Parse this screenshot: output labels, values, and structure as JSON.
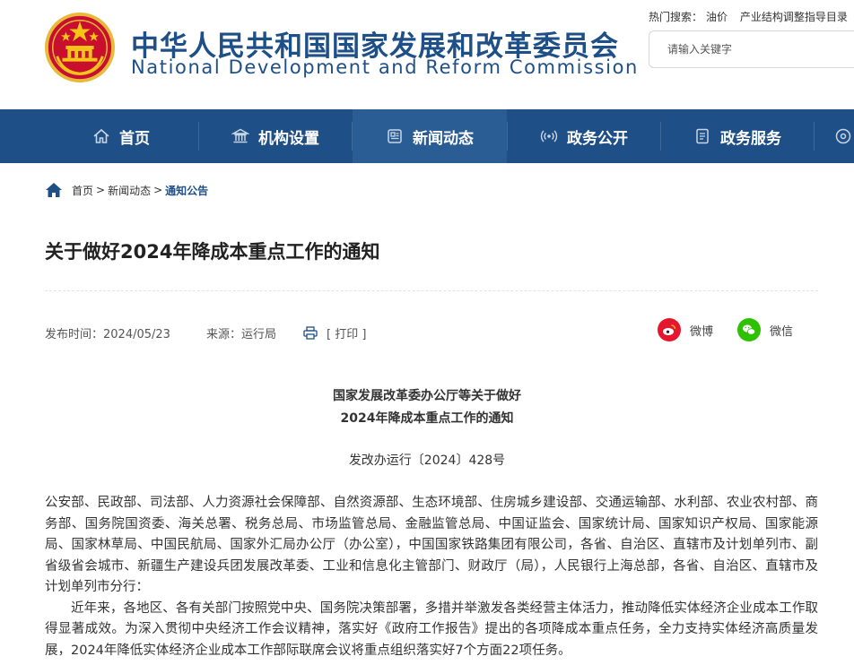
{
  "site": {
    "title_cn": "中华人民共和国国家发展和改革委员会",
    "title_en": "National Development and Reform Commission"
  },
  "hot_search": {
    "label": "热门搜索：",
    "terms": [
      "油价",
      "产业结构调整指导目录"
    ]
  },
  "search": {
    "placeholder": "请输入关键字"
  },
  "nav": {
    "items": [
      {
        "label": "首页",
        "icon": "home-icon"
      },
      {
        "label": "机构设置",
        "icon": "institution-icon"
      },
      {
        "label": "新闻动态",
        "icon": "news-icon"
      },
      {
        "label": "政务公开",
        "icon": "broadcast-icon"
      },
      {
        "label": "政务服务",
        "icon": "document-icon"
      }
    ],
    "active_index": 2
  },
  "breadcrumb": {
    "home": "首页",
    "level1": "新闻动态",
    "current": "通知公告",
    "separator": ">"
  },
  "article": {
    "title": "关于做好2024年降成本重点工作的通知",
    "publish_label": "发布时间：",
    "publish_date": "2024/05/23",
    "source_label": "来源：",
    "source": "运行局",
    "print_label": "[ 打印 ]"
  },
  "share": {
    "weibo": "微博",
    "wechat": "微信"
  },
  "document": {
    "heading_line1": "国家发展改革委办公厅等关于做好",
    "heading_line2": "2024年降成本重点工作的通知",
    "doc_number": "发改办运行〔2024〕428号",
    "recipients": "公安部、民政部、司法部、人力资源社会保障部、自然资源部、生态环境部、住房城乡建设部、交通运输部、水利部、农业农村部、商务部、国务院国资委、海关总署、税务总局、市场监管总局、金融监管总局、中国证监会、国家统计局、国家知识产权局、国家能源局、国家林草局、中国民航局、国家外汇局办公厅（办公室），中国国家铁路集团有限公司，各省、自治区、直辖市及计划单列市、副省级省会城市、新疆生产建设兵团发展改革委、工业和信息化主管部门、财政厅（局），人民银行上海总部，各省、自治区、直辖市及计划单列市分行：",
    "para1": "近年来，各地区、各有关部门按照党中央、国务院决策部署，多措并举激发各类经营主体活力，推动降低实体经济企业成本工作取得显著成效。为深入贯彻中央经济工作会议精神，落实好《政府工作报告》提出的各项降成本重点任务，全力支持实体经济高质量发展，2024年降低实体经济企业成本工作部际联席会议将重点组织落实好7个方面22项任务。"
  },
  "colors": {
    "brand_blue": "#1e4f86",
    "nav_active": "#2a5d94",
    "weibo_red": "#e6162d",
    "wechat_green": "#2dc100"
  }
}
